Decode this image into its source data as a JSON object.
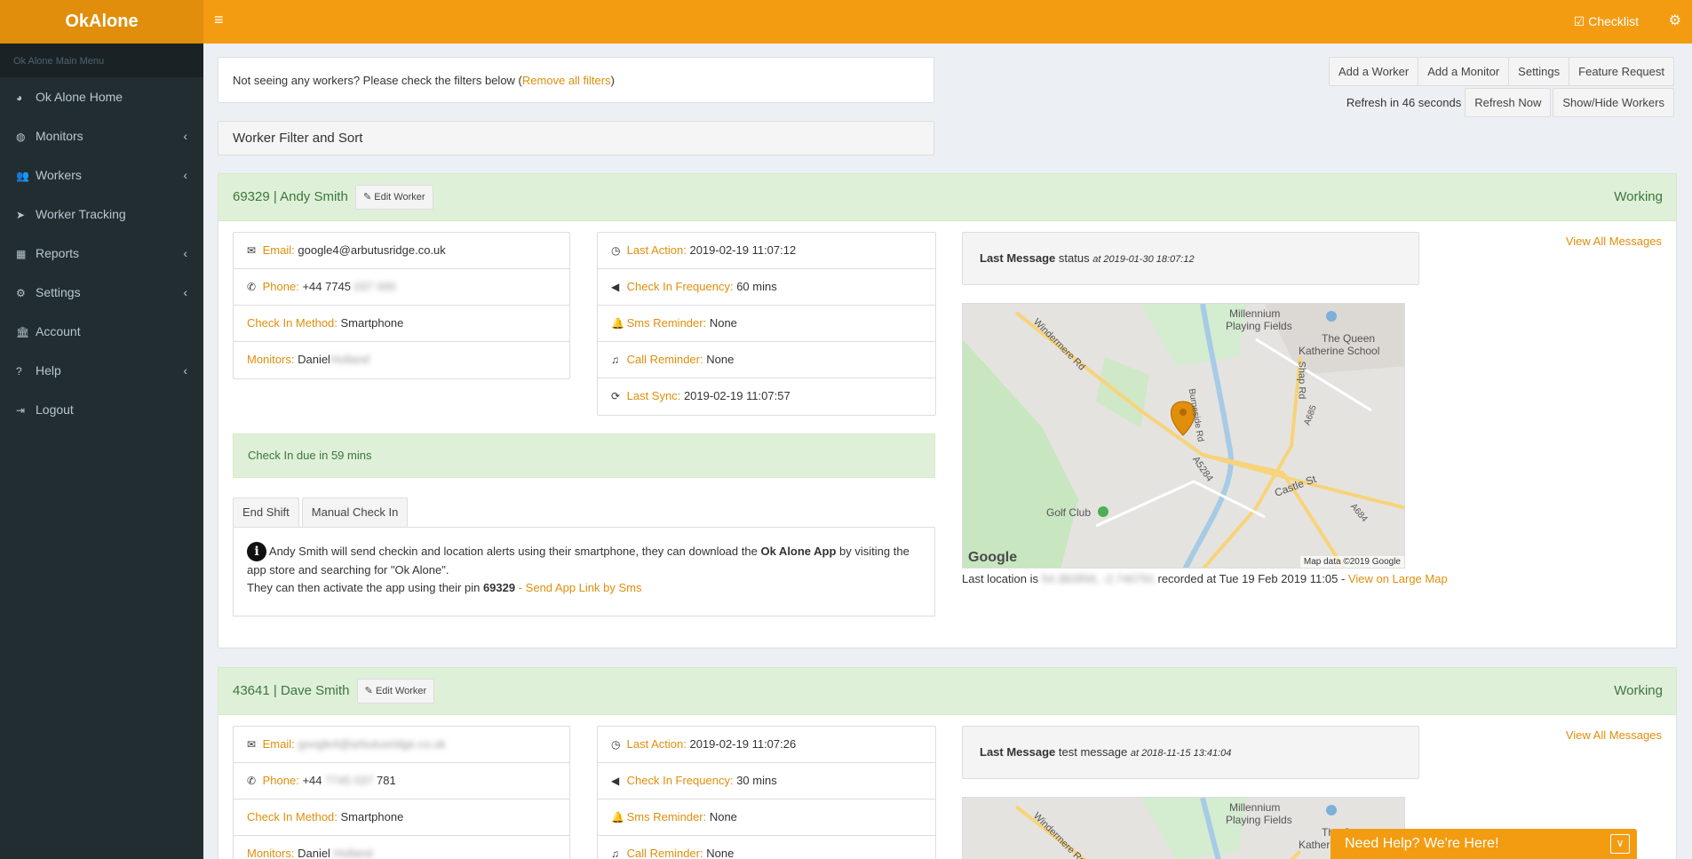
{
  "app": {
    "logo": "OkAlone",
    "checklist": "Checklist"
  },
  "sidebar": {
    "header": "Ok Alone Main Menu",
    "items": [
      {
        "label": "Ok Alone Home",
        "icon": "dashboard-icon",
        "glyph": "◕",
        "chevron": false
      },
      {
        "label": "Monitors",
        "icon": "globe-icon",
        "glyph": "◍",
        "chevron": true
      },
      {
        "label": "Workers",
        "icon": "users-icon",
        "glyph": "👥",
        "chevron": true
      },
      {
        "label": "Worker Tracking",
        "icon": "location-arrow-icon",
        "glyph": "➤",
        "chevron": false
      },
      {
        "label": "Reports",
        "icon": "grid-icon",
        "glyph": "▦",
        "chevron": true
      },
      {
        "label": "Settings",
        "icon": "cogs-icon",
        "glyph": "⚙",
        "chevron": true
      },
      {
        "label": "Account",
        "icon": "bank-icon",
        "glyph": "🏛",
        "chevron": false
      },
      {
        "label": "Help",
        "icon": "question-icon",
        "glyph": "?",
        "chevron": true
      },
      {
        "label": "Logout",
        "icon": "sign-out-icon",
        "glyph": "⇥",
        "chevron": false
      }
    ]
  },
  "notice": {
    "text": "Not seeing any workers? Please check the filters below (",
    "link": "Remove all filters",
    "close": ")"
  },
  "toolbar": {
    "add_worker": "Add a Worker",
    "add_monitor": "Add a Monitor",
    "settings": "Settings",
    "feature_request": "Feature Request",
    "refresh_text": "Refresh in 46 seconds",
    "refresh_now": "Refresh Now",
    "show_hide": "Show/Hide Workers"
  },
  "filter": {
    "title": "Worker Filter and Sort"
  },
  "labels": {
    "email": "Email:",
    "phone": "Phone:",
    "method": "Check In Method:",
    "monitors": "Monitors:",
    "last_action": "Last Action:",
    "frequency": "Check In Frequency:",
    "sms": "Sms Reminder:",
    "call": "Call Reminder:",
    "sync": "Last Sync:",
    "edit": "Edit Worker",
    "view_all": "View All Messages",
    "last_message": "Last Message",
    "status": "Working",
    "end_shift": "End Shift",
    "manual": "Manual Check In"
  },
  "workers": [
    {
      "header": "69329 | Andy Smith",
      "email": "google4@arbutusridge.co.uk",
      "phone": "+44 7745",
      "phone_hidden": "037 000",
      "method": "Smartphone",
      "monitors": "Daniel",
      "monitors_hidden": "Holland",
      "last_action": "2019-02-19 11:07:12",
      "frequency": "60 mins",
      "sms": "None",
      "call": "None",
      "sync": "2019-02-19 11:07:57",
      "message": "status",
      "message_at": "at 2019-01-30 18:07:12",
      "checkin_due": "Check In due in 59 mins",
      "info1_pre": "Andy Smith will send checkin and location alerts using their smartphone, they can download the ",
      "info1_bold": "Ok Alone App",
      "info1_post": " by visiting the app store and searching for \"Ok Alone\".",
      "info2_pre": "They can then activate the app using their pin ",
      "info2_pin": "69329",
      "info2_sep": " - ",
      "info2_link": "Send App Link by Sms",
      "location_pre": "Last location is",
      "location_hidden": "54.382856, -2.740791",
      "location_post": "recorded at Tue 19 Feb 2019 11:05 -",
      "location_link": "View on Large Map"
    },
    {
      "header": "43641 | Dave Smith",
      "email_hidden": "google4@arbutusridge.co.uk",
      "phone": "+44",
      "phone_hidden": "7745 037",
      "phone_tail": "781",
      "method": "Smartphone",
      "monitors": "Daniel",
      "monitors_hidden": "Holland",
      "last_action": "2019-02-19 11:07:26",
      "frequency": "30 mins",
      "sms": "None",
      "call": "None",
      "message": "test message",
      "message_at": "at 2018-11-15 13:41:04"
    }
  ],
  "map": {
    "labels": [
      "Millennium",
      "Playing Fields",
      "The Queen",
      "Katherine School",
      "Windermere Rd",
      "Shap Rd",
      "Burneside Rd",
      "A5284",
      "A685",
      "Castle St",
      "A684",
      "Golf Club"
    ],
    "google": "Google",
    "attribution": "Map data ©2019 Google"
  },
  "help": {
    "text": "Need Help? We're Here!"
  },
  "colors": {
    "brand": "#f39c12",
    "sidebar": "#222d32",
    "success_bg": "#dff0d8",
    "success_text": "#3c763d"
  }
}
